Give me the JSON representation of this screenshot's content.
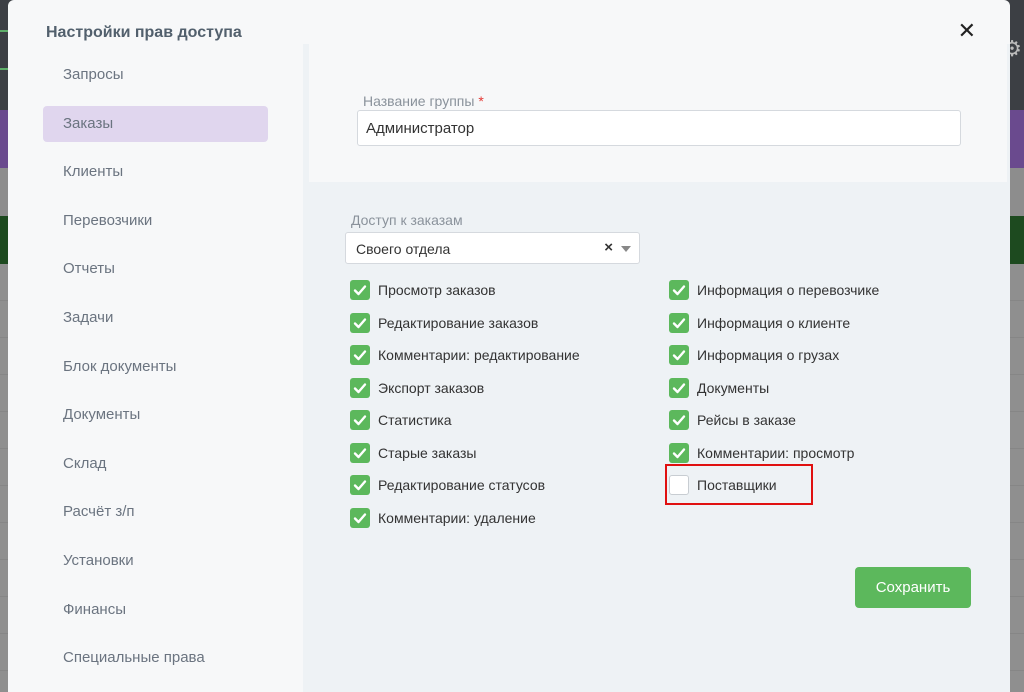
{
  "modal": {
    "title": "Настройки прав доступа",
    "close_label": "✕"
  },
  "sidebar": {
    "items": [
      {
        "label": "Запросы",
        "active": false
      },
      {
        "label": "Заказы",
        "active": true
      },
      {
        "label": "Клиенты",
        "active": false
      },
      {
        "label": "Перевозчики",
        "active": false
      },
      {
        "label": "Отчеты",
        "active": false
      },
      {
        "label": "Задачи",
        "active": false
      },
      {
        "label": "Блок документы",
        "active": false
      },
      {
        "label": "Документы",
        "active": false
      },
      {
        "label": "Склад",
        "active": false
      },
      {
        "label": "Расчёт з/п",
        "active": false
      },
      {
        "label": "Установки",
        "active": false
      },
      {
        "label": "Финансы",
        "active": false
      },
      {
        "label": "Специальные права",
        "active": false
      }
    ]
  },
  "group_name": {
    "label": "Название группы",
    "required_mark": "*",
    "value": "Администратор"
  },
  "order_access": {
    "label": "Доступ к заказам",
    "selected": "Своего отдела",
    "clear_label": "×"
  },
  "permissions_left": [
    {
      "label": "Просмотр заказов",
      "checked": true
    },
    {
      "label": "Редактирование заказов",
      "checked": true
    },
    {
      "label": "Комментарии: редактирование",
      "checked": true
    },
    {
      "label": "Экспорт заказов",
      "checked": true
    },
    {
      "label": "Статистика",
      "checked": true
    },
    {
      "label": "Старые заказы",
      "checked": true
    },
    {
      "label": "Редактирование статусов",
      "checked": true
    },
    {
      "label": "Комментарии: удаление",
      "checked": true
    }
  ],
  "permissions_right": [
    {
      "label": "Информация о перевозчике",
      "checked": true
    },
    {
      "label": "Информация о клиенте",
      "checked": true
    },
    {
      "label": "Информация о грузах",
      "checked": true
    },
    {
      "label": "Документы",
      "checked": true
    },
    {
      "label": "Рейсы в заказе",
      "checked": true
    },
    {
      "label": "Комментарии: просмотр",
      "checked": true
    },
    {
      "label": "Поставщики",
      "checked": false
    }
  ],
  "save_label": "Сохранить",
  "colors": {
    "accent_green": "#5cb85c",
    "active_item": "#e0d6ee",
    "highlight_red": "#e01010"
  }
}
